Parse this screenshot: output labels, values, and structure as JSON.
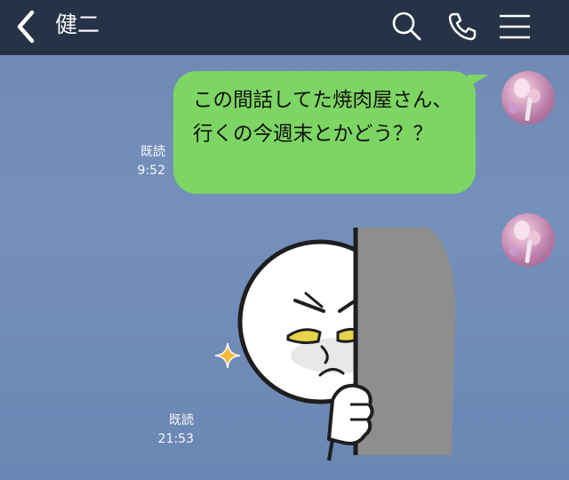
{
  "header": {
    "title": "健二",
    "back_icon": "chevron-left-icon",
    "search_icon": "search-icon",
    "call_icon": "phone-icon",
    "menu_icon": "hamburger-menu-icon"
  },
  "messages": [
    {
      "type": "text",
      "text": "この間話してた焼肉屋さん、行くの今週末とかどう？？",
      "read_label": "既読",
      "time": "9:52"
    },
    {
      "type": "sticker",
      "read_label": "既読",
      "time": "21:53"
    }
  ],
  "colors": {
    "header_bg": "#263347",
    "chat_bg": "#7590ba",
    "bubble": "#7dd563"
  }
}
